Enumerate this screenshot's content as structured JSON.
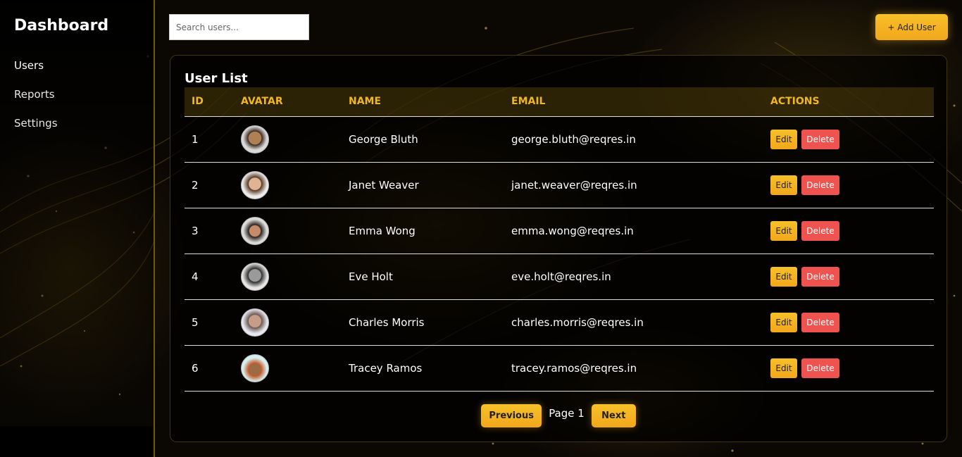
{
  "sidebar": {
    "title": "Dashboard",
    "items": [
      {
        "label": "Users"
      },
      {
        "label": "Reports"
      },
      {
        "label": "Settings"
      }
    ]
  },
  "toolbar": {
    "search_placeholder": "Search users...",
    "add_label": "+ Add User"
  },
  "card": {
    "title": "User List",
    "columns": [
      "ID",
      "AVATAR",
      "NAME",
      "EMAIL",
      "ACTIONS"
    ]
  },
  "users": [
    {
      "id": "1",
      "name": "George Bluth",
      "email": "george.bluth@reqres.in"
    },
    {
      "id": "2",
      "name": "Janet Weaver",
      "email": "janet.weaver@reqres.in"
    },
    {
      "id": "3",
      "name": "Emma Wong",
      "email": "emma.wong@reqres.in"
    },
    {
      "id": "4",
      "name": "Eve Holt",
      "email": "eve.holt@reqres.in"
    },
    {
      "id": "5",
      "name": "Charles Morris",
      "email": "charles.morris@reqres.in"
    },
    {
      "id": "6",
      "name": "Tracey Ramos",
      "email": "tracey.ramos@reqres.in"
    }
  ],
  "actions": {
    "edit": "Edit",
    "delete": "Delete"
  },
  "pagination": {
    "prev": "Previous",
    "page": "Page 1",
    "next": "Next"
  },
  "colors": {
    "accent": "#f2b01e",
    "danger": "#ef5350",
    "background": "#0b0804"
  }
}
